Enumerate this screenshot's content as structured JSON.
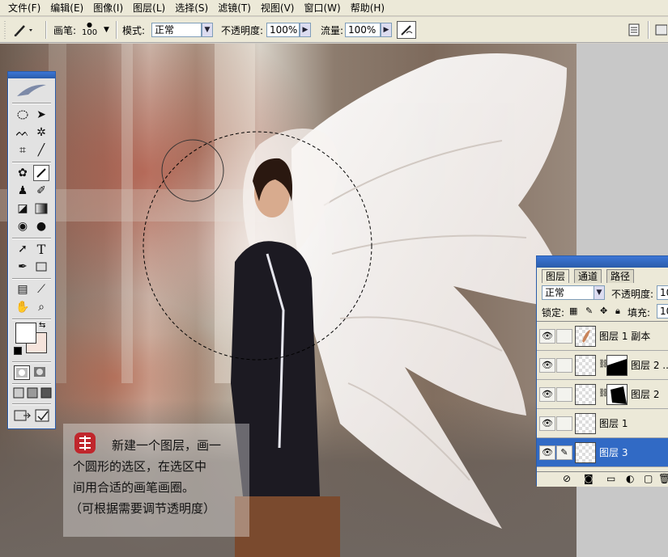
{
  "menu": [
    "文件(F)",
    "编辑(E)",
    "图像(I)",
    "图层(L)",
    "选择(S)",
    "滤镜(T)",
    "视图(V)",
    "窗口(W)",
    "帮助(H)"
  ],
  "options": {
    "brush_label": "画笔:",
    "brush_size": "100",
    "mode_label": "模式:",
    "mode_value": "正常",
    "opacity_label": "不透明度:",
    "opacity_value": "100%",
    "flow_label": "流量:",
    "flow_value": "100%"
  },
  "tools": [
    "marquee-ellipse",
    "move",
    "lasso",
    "magic-wand",
    "crop",
    "eyedropper-slice",
    "healing-brush",
    "brush",
    "clone-stamp",
    "history-brush",
    "eraser",
    "gradient",
    "blur",
    "dodge",
    "path-select",
    "type",
    "pen",
    "shape",
    "notes",
    "eyedropper",
    "hand",
    "zoom"
  ],
  "layers_panel": {
    "tabs": [
      "图层",
      "通道",
      "路径"
    ],
    "blend_mode": "正常",
    "opacity_label": "不透明度:",
    "opacity_value": "10",
    "lock_label": "锁定:",
    "fill_label": "填充:",
    "fill_value": "10",
    "layers": [
      {
        "name": "图层 1 副本",
        "selected": false,
        "mask": false
      },
      {
        "name": "图层 2 ...",
        "selected": false,
        "mask": true
      },
      {
        "name": "图层 2",
        "selected": false,
        "mask": true
      },
      {
        "name": "图层 1",
        "selected": false,
        "mask": false
      },
      {
        "name": "图层 3",
        "selected": true,
        "mask": false
      }
    ]
  },
  "caption": {
    "line1": "新建一个图层，画一",
    "line2": "个圆形的选区，在选区中",
    "line3": "间用合适的画笔画圈。",
    "line4": "（可根据需要调节透明度）"
  },
  "colors": {
    "selection": "#316ac5",
    "panel_bg": "#ece9d8",
    "panel_border": "#2a5caa",
    "seal": "#c0262c"
  }
}
